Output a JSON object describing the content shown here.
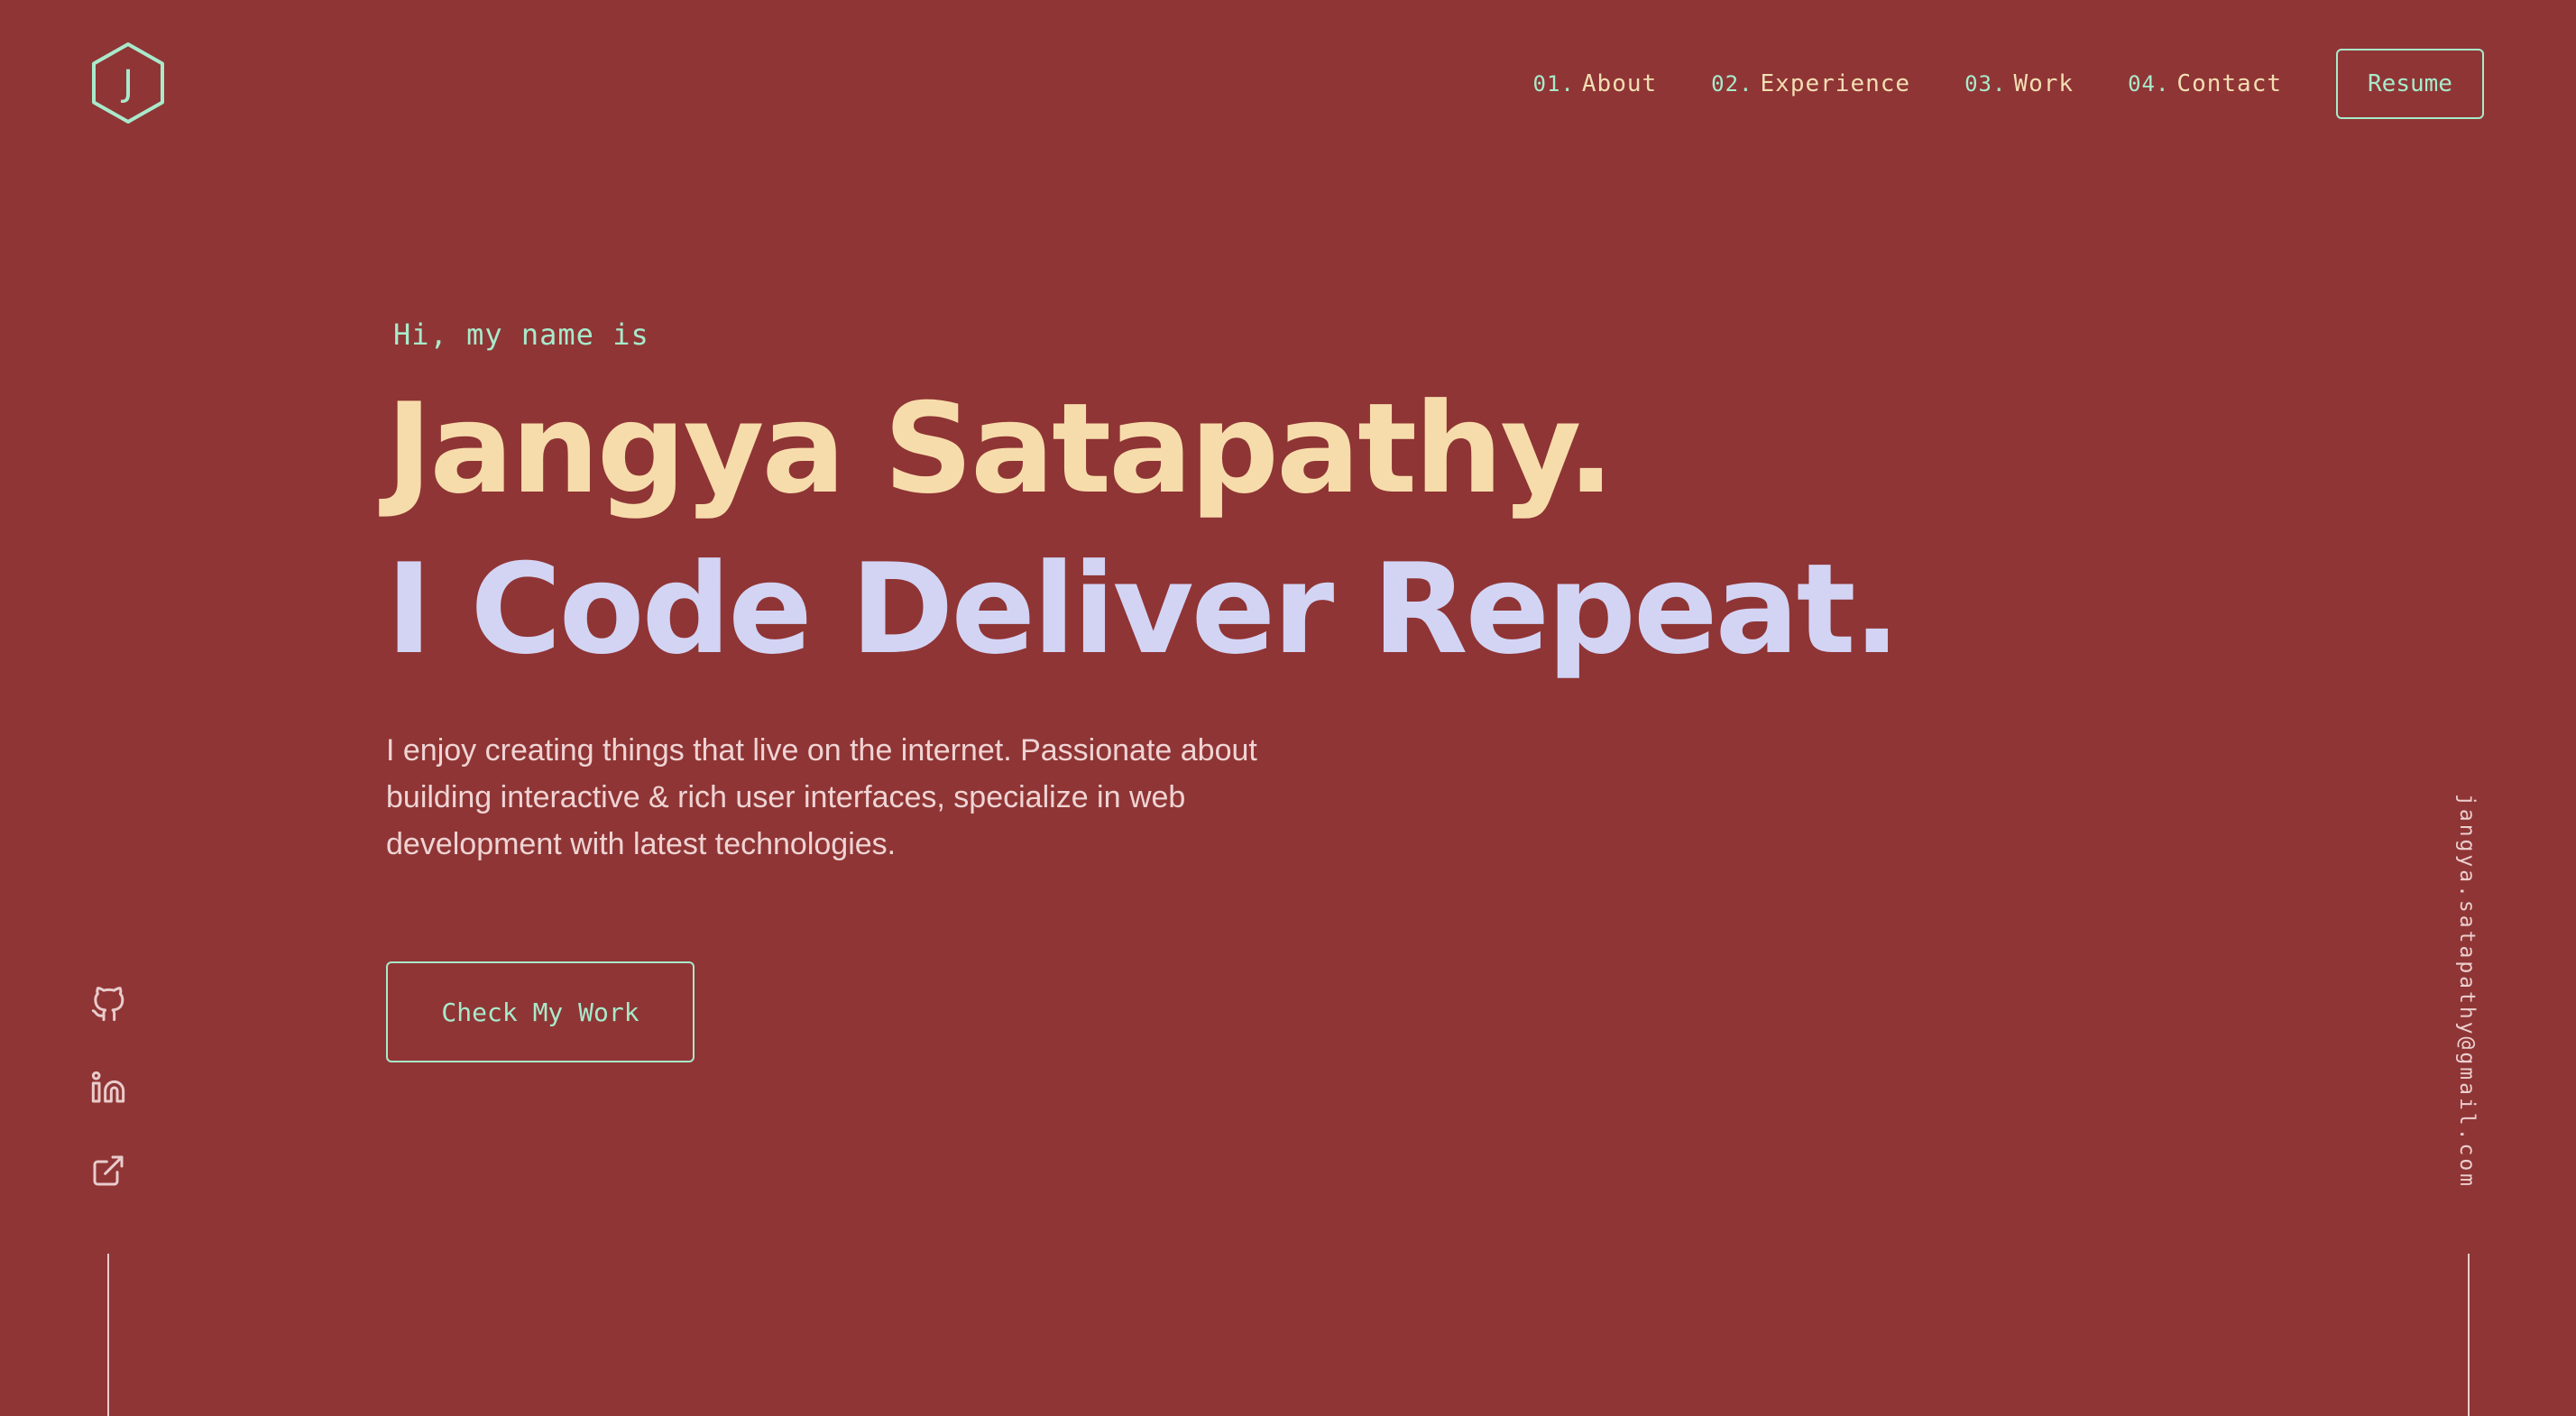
{
  "logo": {
    "letter": "J",
    "icon": "hexagon-logo-icon"
  },
  "nav": {
    "items": [
      {
        "num": "01.",
        "label": "About"
      },
      {
        "num": "02.",
        "label": "Experience"
      },
      {
        "num": "03.",
        "label": "Work"
      },
      {
        "num": "04.",
        "label": "Contact"
      }
    ],
    "resume_label": "Resume"
  },
  "hero": {
    "greeting": "Hi, my name is",
    "name": "Jangya Satapathy.",
    "tagline": "I Code Deliver Repeat.",
    "intro": "I enjoy creating things that live on the internet. Passionate about building interactive & rich user interfaces, specialize in web development with latest technologies.",
    "cta_label": "Check My Work"
  },
  "social": [
    {
      "icon": "github-icon"
    },
    {
      "icon": "linkedin-icon"
    },
    {
      "icon": "external-link-icon"
    }
  ],
  "email": "jangya.satapathy@gmail.com",
  "colors": {
    "background": "#8f3535",
    "accent": "#a8eacb",
    "name": "#f7dcab",
    "tagline": "#d3d4f4",
    "text": "#f0d4d4"
  }
}
